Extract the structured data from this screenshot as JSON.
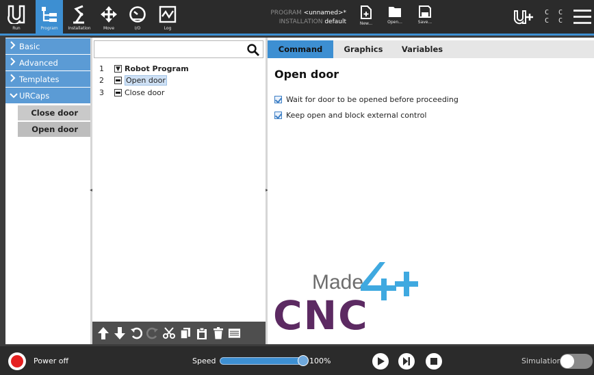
{
  "topbar": {
    "nav": [
      {
        "label": "Run",
        "icon": "ur-logo-icon"
      },
      {
        "label": "Program",
        "icon": "program-tree-icon"
      },
      {
        "label": "Installation",
        "icon": "robot-arm-icon"
      },
      {
        "label": "Move",
        "icon": "move-arrows-icon"
      },
      {
        "label": "I/O",
        "icon": "io-gauge-icon"
      },
      {
        "label": "Log",
        "icon": "log-chart-icon"
      }
    ],
    "program_label": "PROGRAM",
    "program_value": "<unnamed>*",
    "installation_label": "INSTALLATION",
    "installation_value": "default",
    "file_buttons": [
      {
        "label": "New...",
        "icon": "new-file-icon"
      },
      {
        "label": "Open...",
        "icon": "folder-icon"
      },
      {
        "label": "Save...",
        "icon": "save-icon"
      }
    ],
    "cc_text": "C C",
    "cc_text2": "C C"
  },
  "leftmenu": {
    "categories": [
      {
        "label": "Basic",
        "expanded": false
      },
      {
        "label": "Advanced",
        "expanded": false
      },
      {
        "label": "Templates",
        "expanded": false
      },
      {
        "label": "URCaps",
        "expanded": true
      }
    ],
    "urcaps_items": [
      {
        "label": "Close door"
      },
      {
        "label": "Open door"
      }
    ]
  },
  "tree": {
    "search_placeholder": "",
    "rows": [
      {
        "num": "1",
        "label": "Robot Program"
      },
      {
        "num": "2",
        "label": "Open door"
      },
      {
        "num": "3",
        "label": "Close door"
      }
    ]
  },
  "rightpanel": {
    "tabs": [
      {
        "label": "Command"
      },
      {
        "label": "Graphics"
      },
      {
        "label": "Variables"
      }
    ],
    "title": "Open door",
    "options": [
      {
        "label": "Wait for door to be opened before proceeding",
        "checked": true
      },
      {
        "label": "Keep open and block external control",
        "checked": true
      }
    ],
    "logo_text_top": "Made",
    "logo_text_bottom": "CNC",
    "logo_number": "4",
    "colors": {
      "logo_purple": "#5c2a62",
      "logo_blue": "#3fa9e0",
      "logo_gray": "#6d6d6d"
    }
  },
  "bottombar": {
    "power_label": "Power off",
    "speed_label": "Speed",
    "speed_value": "100%",
    "speed_fraction": 1.0,
    "simulation_label": "Simulation",
    "simulation_on": false
  },
  "colors": {
    "accent": "#3d8fd2",
    "topbar_bg": "#2b2b2b",
    "menu_blue": "#5b9bd5",
    "power_red": "#e52020"
  }
}
